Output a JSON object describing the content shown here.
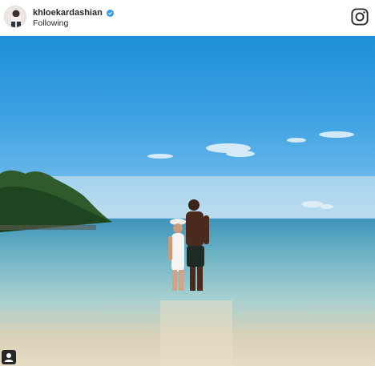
{
  "post": {
    "username": "khloekardashian",
    "follow_status": "Following",
    "verified": true
  },
  "icons": {
    "avatar": "profile-avatar",
    "verified": "verified-badge-icon",
    "app": "instagram-logo-icon",
    "tag": "user-tag-icon"
  },
  "colors": {
    "verified_blue": "#3897f0",
    "text": "#262626"
  }
}
